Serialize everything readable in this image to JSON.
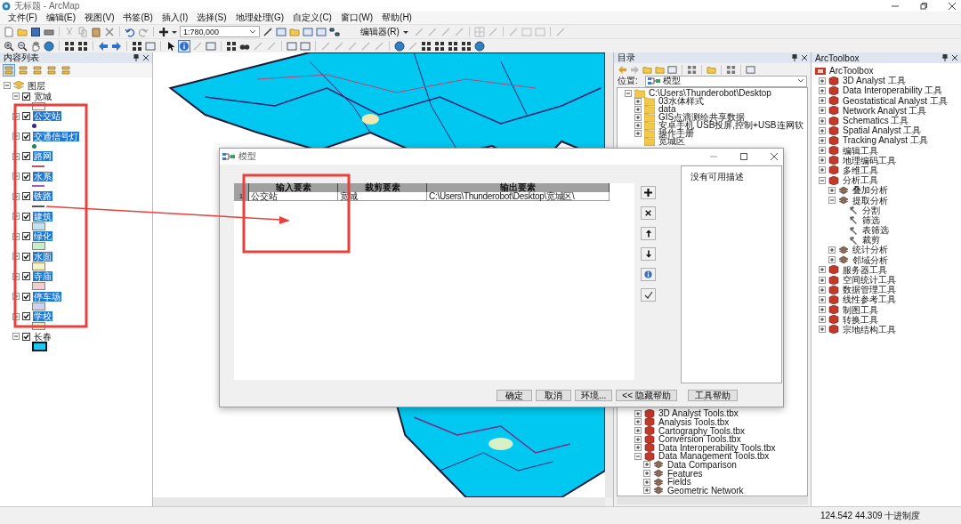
{
  "window": {
    "title": "无标题 - ArcMap"
  },
  "menu": [
    "文件(F)",
    "编辑(E)",
    "视图(V)",
    "书签(B)",
    "插入(I)",
    "选择(S)",
    "地理处理(G)",
    "自定义(C)",
    "窗口(W)",
    "帮助(H)"
  ],
  "toolbar": {
    "scale": "1:780,000",
    "editor_menu": "编辑器(R)"
  },
  "toc": {
    "title": "内容列表",
    "root": {
      "label": "图层",
      "expanded": true
    },
    "layers": [
      {
        "label": "宽城",
        "checked": true,
        "selected": false,
        "expanded": true,
        "kind": "fill",
        "color": "#f7f7f7"
      },
      {
        "label": "公交站",
        "checked": true,
        "selected": true,
        "expanded": true,
        "kind": "point",
        "color": "#3b2a7e"
      },
      {
        "label": "交通信号灯",
        "checked": true,
        "selected": true,
        "expanded": true,
        "kind": "point",
        "color": "#2e7d5b"
      },
      {
        "label": "路网",
        "checked": true,
        "selected": true,
        "expanded": true,
        "kind": "line",
        "color": "#c0506a"
      },
      {
        "label": "水系",
        "checked": true,
        "selected": true,
        "expanded": true,
        "kind": "line",
        "color": "#9b5fc0"
      },
      {
        "label": "铁路",
        "checked": true,
        "selected": true,
        "expanded": true,
        "kind": "rail",
        "color": "#555555"
      },
      {
        "label": "建筑",
        "checked": true,
        "selected": true,
        "expanded": true,
        "kind": "fill",
        "color": "#bfe3f0"
      },
      {
        "label": "绿化",
        "checked": true,
        "selected": true,
        "expanded": true,
        "kind": "fill",
        "color": "#c8f0c8"
      },
      {
        "label": "水面",
        "checked": true,
        "selected": true,
        "expanded": true,
        "kind": "fill",
        "color": "#f7f3c0"
      },
      {
        "label": "寺庙",
        "checked": true,
        "selected": true,
        "expanded": true,
        "kind": "fill",
        "color": "#f0d0d0"
      },
      {
        "label": "停车场",
        "checked": true,
        "selected": true,
        "expanded": true,
        "kind": "fill",
        "color": "#d0d0f0"
      },
      {
        "label": "学校",
        "checked": true,
        "selected": true,
        "expanded": true,
        "kind": "fill",
        "color": "#f7ecc0"
      },
      {
        "label": "长春",
        "checked": true,
        "selected": false,
        "expanded": true,
        "kind": "fill",
        "color": "#1ec8f0"
      }
    ]
  },
  "dialog": {
    "title": "模型",
    "columns": [
      "输入要素",
      "裁剪要素",
      "输出要素"
    ],
    "rows": [
      {
        "index": "1",
        "cells": [
          "公交站",
          "宽城",
          "C:\\Users\\Thunderobot\\Desktop\\宽城区\\"
        ]
      }
    ],
    "help": "没有可用描述",
    "buttons": [
      "确定",
      "取消",
      "环境...",
      "<< 隐藏帮助",
      "工具帮助"
    ]
  },
  "catalog": {
    "title": "目录",
    "location_label": "位置:",
    "location": "模型",
    "tree_top": [
      {
        "label": "C:\\Users\\Thunderobot\\Desktop",
        "kind": "folder",
        "expanded": true,
        "children": [
          {
            "label": "03水体样式",
            "kind": "folder",
            "expanded": false
          },
          {
            "label": "data",
            "kind": "folder",
            "expanded": false
          },
          {
            "label": "GIS点滴测绘共享数据",
            "kind": "folder",
            "expanded": false
          },
          {
            "label": "安卓手机 USB投屏,控制+USB连网软",
            "kind": "folder",
            "expanded": false
          },
          {
            "label": "操作手册",
            "kind": "folder",
            "expanded": false
          },
          {
            "label": "宽城区",
            "kind": "folder"
          }
        ]
      }
    ],
    "tree_bottom": [
      {
        "label": "3D Analyst Tools.tbx",
        "kind": "toolbox",
        "expanded": false
      },
      {
        "label": "Analysis Tools.tbx",
        "kind": "toolbox",
        "expanded": false
      },
      {
        "label": "Cartography Tools.tbx",
        "kind": "toolbox",
        "expanded": false
      },
      {
        "label": "Conversion Tools.tbx",
        "kind": "toolbox",
        "expanded": false
      },
      {
        "label": "Data Interoperability Tools.tbx",
        "kind": "toolbox",
        "expanded": false
      },
      {
        "label": "Data Management Tools.tbx",
        "kind": "toolbox",
        "expanded": true,
        "children": [
          {
            "label": "Data Comparison",
            "kind": "toolset",
            "expanded": false
          },
          {
            "label": "Features",
            "kind": "toolset",
            "expanded": false
          },
          {
            "label": "Fields",
            "kind": "toolset",
            "expanded": false
          },
          {
            "label": "Geometric Network",
            "kind": "toolset",
            "expanded": false
          }
        ]
      }
    ]
  },
  "toolbox": {
    "title": "ArcToolbox",
    "root": "ArcToolbox",
    "items": [
      {
        "label": "3D Analyst 工具",
        "kind": "toolbox",
        "expanded": false
      },
      {
        "label": "Data Interoperability 工具",
        "kind": "toolbox",
        "expanded": false
      },
      {
        "label": "Geostatistical Analyst 工具",
        "kind": "toolbox",
        "expanded": false
      },
      {
        "label": "Network Analyst 工具",
        "kind": "toolbox",
        "expanded": false
      },
      {
        "label": "Schematics 工具",
        "kind": "toolbox",
        "expanded": false
      },
      {
        "label": "Spatial Analyst 工具",
        "kind": "toolbox",
        "expanded": false
      },
      {
        "label": "Tracking Analyst 工具",
        "kind": "toolbox",
        "expanded": false
      },
      {
        "label": "编辑工具",
        "kind": "toolbox",
        "expanded": false
      },
      {
        "label": "地理编码工具",
        "kind": "toolbox",
        "expanded": false
      },
      {
        "label": "多维工具",
        "kind": "toolbox",
        "expanded": false
      },
      {
        "label": "分析工具",
        "kind": "toolbox",
        "expanded": true,
        "children": [
          {
            "label": "叠加分析",
            "kind": "toolset",
            "expanded": false
          },
          {
            "label": "提取分析",
            "kind": "toolset",
            "expanded": true,
            "children": [
              {
                "label": "分割",
                "kind": "tool"
              },
              {
                "label": "筛选",
                "kind": "tool"
              },
              {
                "label": "表筛选",
                "kind": "tool"
              },
              {
                "label": "裁剪",
                "kind": "tool"
              }
            ]
          },
          {
            "label": "统计分析",
            "kind": "toolset",
            "expanded": false
          },
          {
            "label": "邻域分析",
            "kind": "toolset",
            "expanded": false
          }
        ]
      },
      {
        "label": "服务器工具",
        "kind": "toolbox",
        "expanded": false
      },
      {
        "label": "空间统计工具",
        "kind": "toolbox",
        "expanded": false
      },
      {
        "label": "数据管理工具",
        "kind": "toolbox",
        "expanded": false
      },
      {
        "label": "线性参考工具",
        "kind": "toolbox",
        "expanded": false
      },
      {
        "label": "制图工具",
        "kind": "toolbox",
        "expanded": false
      },
      {
        "label": "转换工具",
        "kind": "toolbox",
        "expanded": false
      },
      {
        "label": "宗地结构工具",
        "kind": "toolbox",
        "expanded": false
      }
    ]
  },
  "status_bar": {
    "coordinates": "124.542  44.309 十进制度"
  }
}
